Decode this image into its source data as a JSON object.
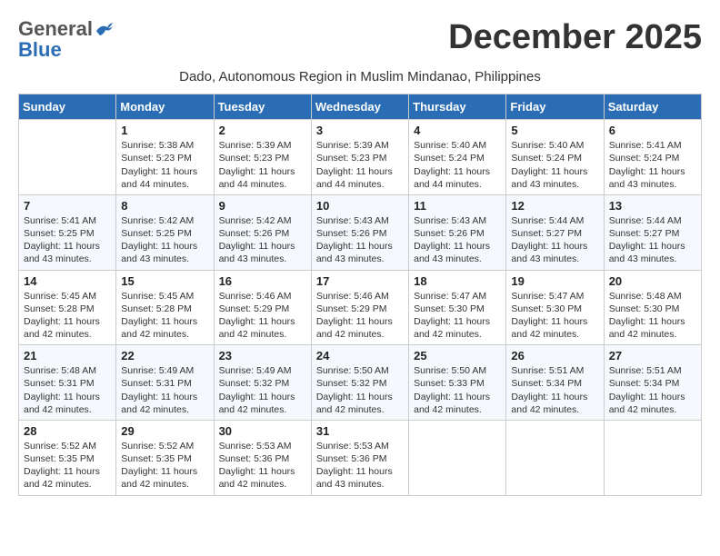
{
  "header": {
    "logo_general": "General",
    "logo_blue": "Blue",
    "month_title": "December 2025",
    "subtitle": "Dado, Autonomous Region in Muslim Mindanao, Philippines"
  },
  "weekdays": [
    "Sunday",
    "Monday",
    "Tuesday",
    "Wednesday",
    "Thursday",
    "Friday",
    "Saturday"
  ],
  "weeks": [
    [
      {
        "day": "",
        "sunrise": "",
        "sunset": "",
        "daylight": ""
      },
      {
        "day": "1",
        "sunrise": "Sunrise: 5:38 AM",
        "sunset": "Sunset: 5:23 PM",
        "daylight": "Daylight: 11 hours and 44 minutes."
      },
      {
        "day": "2",
        "sunrise": "Sunrise: 5:39 AM",
        "sunset": "Sunset: 5:23 PM",
        "daylight": "Daylight: 11 hours and 44 minutes."
      },
      {
        "day": "3",
        "sunrise": "Sunrise: 5:39 AM",
        "sunset": "Sunset: 5:23 PM",
        "daylight": "Daylight: 11 hours and 44 minutes."
      },
      {
        "day": "4",
        "sunrise": "Sunrise: 5:40 AM",
        "sunset": "Sunset: 5:24 PM",
        "daylight": "Daylight: 11 hours and 44 minutes."
      },
      {
        "day": "5",
        "sunrise": "Sunrise: 5:40 AM",
        "sunset": "Sunset: 5:24 PM",
        "daylight": "Daylight: 11 hours and 43 minutes."
      },
      {
        "day": "6",
        "sunrise": "Sunrise: 5:41 AM",
        "sunset": "Sunset: 5:24 PM",
        "daylight": "Daylight: 11 hours and 43 minutes."
      }
    ],
    [
      {
        "day": "7",
        "sunrise": "Sunrise: 5:41 AM",
        "sunset": "Sunset: 5:25 PM",
        "daylight": "Daylight: 11 hours and 43 minutes."
      },
      {
        "day": "8",
        "sunrise": "Sunrise: 5:42 AM",
        "sunset": "Sunset: 5:25 PM",
        "daylight": "Daylight: 11 hours and 43 minutes."
      },
      {
        "day": "9",
        "sunrise": "Sunrise: 5:42 AM",
        "sunset": "Sunset: 5:26 PM",
        "daylight": "Daylight: 11 hours and 43 minutes."
      },
      {
        "day": "10",
        "sunrise": "Sunrise: 5:43 AM",
        "sunset": "Sunset: 5:26 PM",
        "daylight": "Daylight: 11 hours and 43 minutes."
      },
      {
        "day": "11",
        "sunrise": "Sunrise: 5:43 AM",
        "sunset": "Sunset: 5:26 PM",
        "daylight": "Daylight: 11 hours and 43 minutes."
      },
      {
        "day": "12",
        "sunrise": "Sunrise: 5:44 AM",
        "sunset": "Sunset: 5:27 PM",
        "daylight": "Daylight: 11 hours and 43 minutes."
      },
      {
        "day": "13",
        "sunrise": "Sunrise: 5:44 AM",
        "sunset": "Sunset: 5:27 PM",
        "daylight": "Daylight: 11 hours and 43 minutes."
      }
    ],
    [
      {
        "day": "14",
        "sunrise": "Sunrise: 5:45 AM",
        "sunset": "Sunset: 5:28 PM",
        "daylight": "Daylight: 11 hours and 42 minutes."
      },
      {
        "day": "15",
        "sunrise": "Sunrise: 5:45 AM",
        "sunset": "Sunset: 5:28 PM",
        "daylight": "Daylight: 11 hours and 42 minutes."
      },
      {
        "day": "16",
        "sunrise": "Sunrise: 5:46 AM",
        "sunset": "Sunset: 5:29 PM",
        "daylight": "Daylight: 11 hours and 42 minutes."
      },
      {
        "day": "17",
        "sunrise": "Sunrise: 5:46 AM",
        "sunset": "Sunset: 5:29 PM",
        "daylight": "Daylight: 11 hours and 42 minutes."
      },
      {
        "day": "18",
        "sunrise": "Sunrise: 5:47 AM",
        "sunset": "Sunset: 5:30 PM",
        "daylight": "Daylight: 11 hours and 42 minutes."
      },
      {
        "day": "19",
        "sunrise": "Sunrise: 5:47 AM",
        "sunset": "Sunset: 5:30 PM",
        "daylight": "Daylight: 11 hours and 42 minutes."
      },
      {
        "day": "20",
        "sunrise": "Sunrise: 5:48 AM",
        "sunset": "Sunset: 5:30 PM",
        "daylight": "Daylight: 11 hours and 42 minutes."
      }
    ],
    [
      {
        "day": "21",
        "sunrise": "Sunrise: 5:48 AM",
        "sunset": "Sunset: 5:31 PM",
        "daylight": "Daylight: 11 hours and 42 minutes."
      },
      {
        "day": "22",
        "sunrise": "Sunrise: 5:49 AM",
        "sunset": "Sunset: 5:31 PM",
        "daylight": "Daylight: 11 hours and 42 minutes."
      },
      {
        "day": "23",
        "sunrise": "Sunrise: 5:49 AM",
        "sunset": "Sunset: 5:32 PM",
        "daylight": "Daylight: 11 hours and 42 minutes."
      },
      {
        "day": "24",
        "sunrise": "Sunrise: 5:50 AM",
        "sunset": "Sunset: 5:32 PM",
        "daylight": "Daylight: 11 hours and 42 minutes."
      },
      {
        "day": "25",
        "sunrise": "Sunrise: 5:50 AM",
        "sunset": "Sunset: 5:33 PM",
        "daylight": "Daylight: 11 hours and 42 minutes."
      },
      {
        "day": "26",
        "sunrise": "Sunrise: 5:51 AM",
        "sunset": "Sunset: 5:34 PM",
        "daylight": "Daylight: 11 hours and 42 minutes."
      },
      {
        "day": "27",
        "sunrise": "Sunrise: 5:51 AM",
        "sunset": "Sunset: 5:34 PM",
        "daylight": "Daylight: 11 hours and 42 minutes."
      }
    ],
    [
      {
        "day": "28",
        "sunrise": "Sunrise: 5:52 AM",
        "sunset": "Sunset: 5:35 PM",
        "daylight": "Daylight: 11 hours and 42 minutes."
      },
      {
        "day": "29",
        "sunrise": "Sunrise: 5:52 AM",
        "sunset": "Sunset: 5:35 PM",
        "daylight": "Daylight: 11 hours and 42 minutes."
      },
      {
        "day": "30",
        "sunrise": "Sunrise: 5:53 AM",
        "sunset": "Sunset: 5:36 PM",
        "daylight": "Daylight: 11 hours and 42 minutes."
      },
      {
        "day": "31",
        "sunrise": "Sunrise: 5:53 AM",
        "sunset": "Sunset: 5:36 PM",
        "daylight": "Daylight: 11 hours and 43 minutes."
      },
      {
        "day": "",
        "sunrise": "",
        "sunset": "",
        "daylight": ""
      },
      {
        "day": "",
        "sunrise": "",
        "sunset": "",
        "daylight": ""
      },
      {
        "day": "",
        "sunrise": "",
        "sunset": "",
        "daylight": ""
      }
    ]
  ]
}
